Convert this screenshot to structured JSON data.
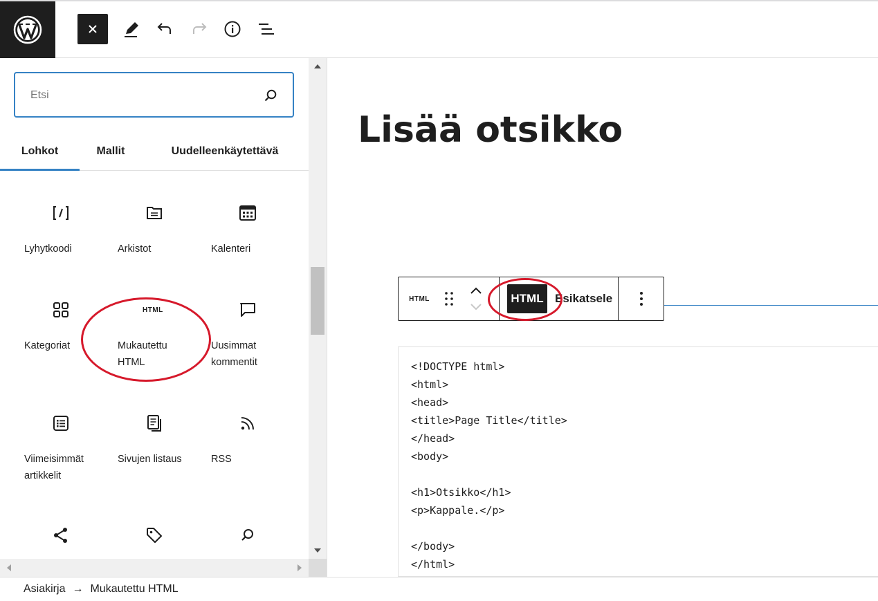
{
  "toolbar": {
    "logo": "wordpress-logo",
    "icons": [
      "close-icon",
      "pencil-icon",
      "undo-icon",
      "redo-icon",
      "info-icon",
      "list-view-icon"
    ]
  },
  "inserter": {
    "search_placeholder": "Etsi",
    "tabs": [
      "Lohkot",
      "Mallit",
      "Uudelleenkäytettävä"
    ],
    "blocks": [
      {
        "label": "Lyhytkoodi",
        "icon": "shortcode-icon"
      },
      {
        "label": "Arkistot",
        "icon": "archive-folder-icon"
      },
      {
        "label": "Kalenteri",
        "icon": "calendar-icon"
      },
      {
        "label": "Kategoriat",
        "icon": "categories-grid-icon"
      },
      {
        "label": "Mukautettu HTML",
        "icon": "html-icon",
        "icon_text": "HTML"
      },
      {
        "label": "Uusimmat kommentit",
        "icon": "comment-icon"
      },
      {
        "label": "Viimeisimmät artikkelit",
        "icon": "post-list-icon"
      },
      {
        "label": "Sivujen listaus",
        "icon": "pages-icon"
      },
      {
        "label": "RSS",
        "icon": "rss-icon"
      },
      {
        "label": "",
        "icon": "share-icon"
      },
      {
        "label": "",
        "icon": "tag-icon"
      },
      {
        "label": "",
        "icon": "search-icon"
      }
    ]
  },
  "editor": {
    "title": "Lisää otsikko",
    "block_toolbar": {
      "block_type_label": "HTML",
      "html_label": "HTML",
      "preview_label": "Esikatsele"
    },
    "code": "<!DOCTYPE html>\n<html>\n<head>\n<title>Page Title</title>\n</head>\n<body>\n\n<h1>Otsikko</h1>\n<p>Kappale.</p>\n\n</body>\n</html>"
  },
  "breadcrumb": {
    "root": "Asiakirja",
    "separator": "→",
    "current": "Mukautettu HTML"
  },
  "colors": {
    "accent": "#3582c4",
    "annotation": "#d6192b",
    "dark": "#1e1e1e"
  }
}
